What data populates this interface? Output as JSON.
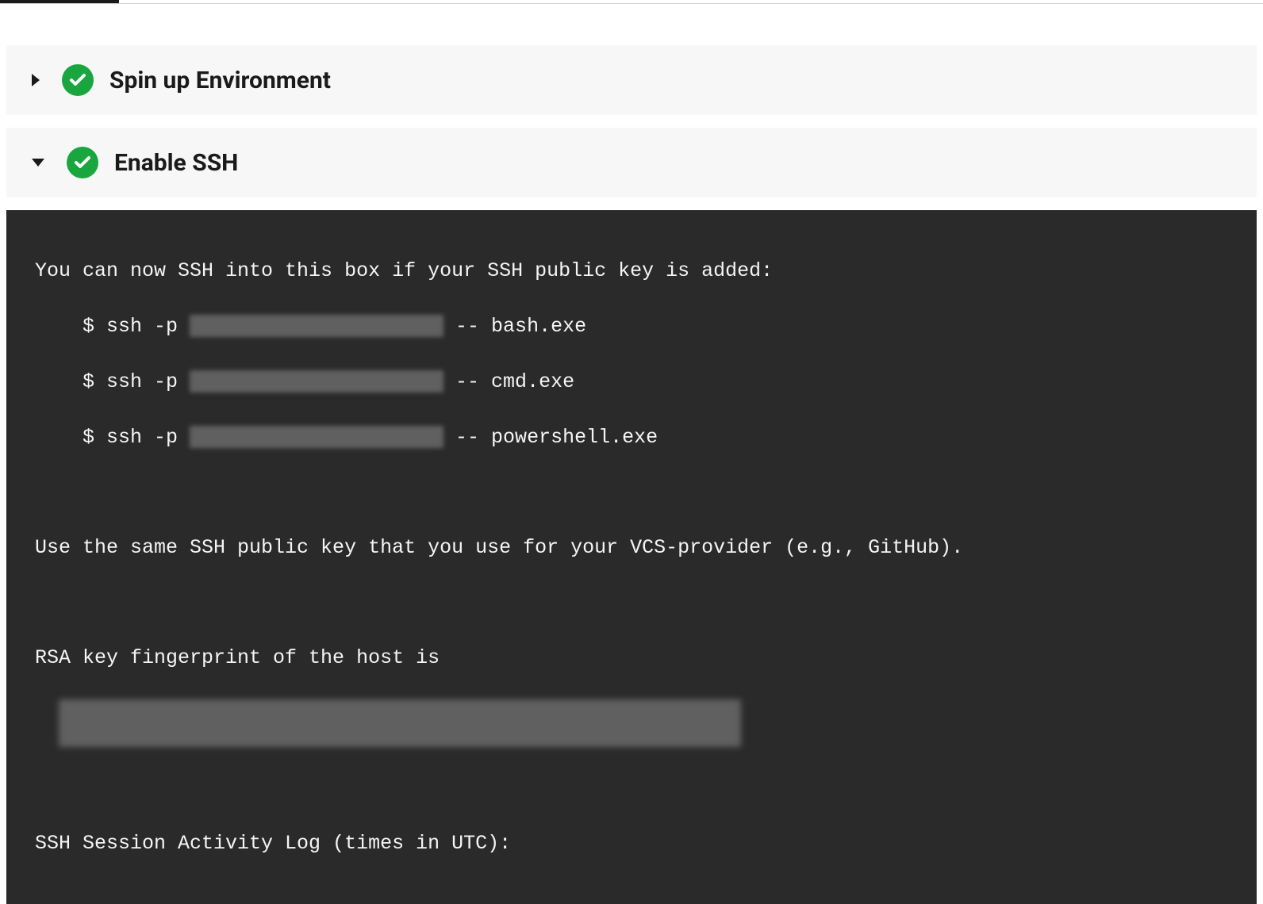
{
  "steps": [
    {
      "title": "Spin up Environment",
      "expanded": false,
      "status": "success"
    },
    {
      "title": "Enable SSH",
      "expanded": true,
      "status": "success"
    }
  ],
  "terminal": {
    "intro": "You can now SSH into this box if your SSH public key is added:",
    "ssh_prefix": "    $ ssh -p ",
    "ssh_cmds": [
      {
        "suffix": " -- bash.exe"
      },
      {
        "suffix": " -- cmd.exe"
      },
      {
        "suffix": " -- powershell.exe"
      }
    ],
    "vcs_note": "Use the same SSH public key that you use for your VCS-provider (e.g., GitHub).",
    "rsa_label": "RSA key fingerprint of the host is",
    "log_label": "SSH Session Activity Log (times in UTC):"
  }
}
